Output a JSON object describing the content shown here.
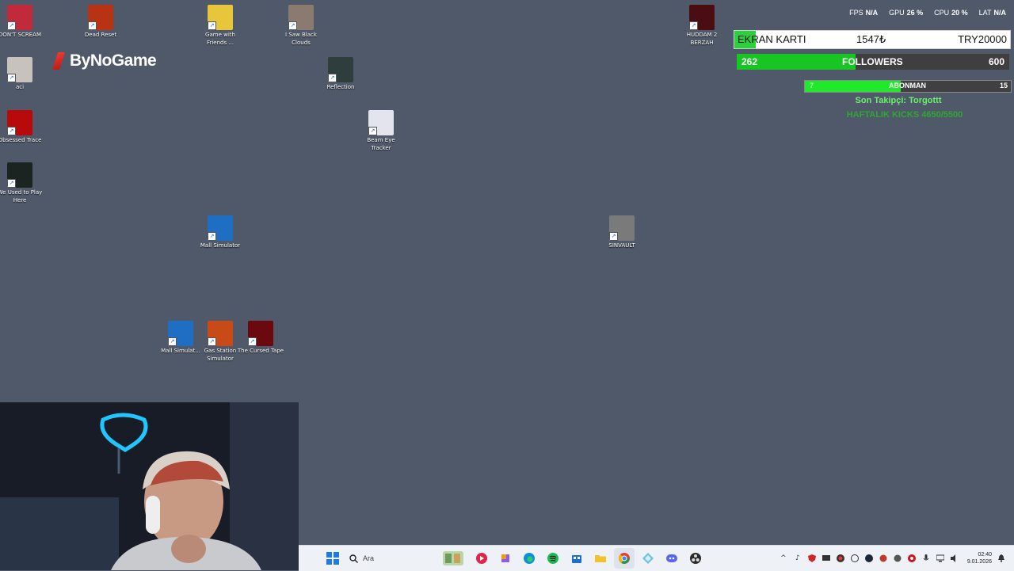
{
  "desktop_icons": [
    {
      "label": "DON'T SCREAM",
      "icon": "dont-scream-icon",
      "color": "#c12a3a"
    },
    {
      "label": "Dead Reset",
      "icon": "dead-reset-icon",
      "color": "#b83313"
    },
    {
      "label": "Game with Friends ...",
      "icon": "game-with-friends-icon",
      "color": "#e8c63a"
    },
    {
      "label": "I Saw Black Clouds",
      "icon": "i-saw-black-clouds-icon",
      "color": "#8a7a70"
    },
    {
      "label": "HUDDAM 2 BERZAH",
      "icon": "huddam-icon",
      "color": "#4a0e12"
    },
    {
      "label": "aci",
      "icon": "aci-icon",
      "color": "#c7c2bb"
    },
    {
      "label": "Reflection",
      "icon": "reflection-icon",
      "color": "#2e3e3c"
    },
    {
      "label": "Obsessed Trace",
      "icon": "obsessed-trace-icon",
      "color": "#b80a0a"
    },
    {
      "label": "Beam Eye Tracker",
      "icon": "beam-eye-tracker-icon",
      "color": "#e4e4ee"
    },
    {
      "label": "We Used to Play Here",
      "icon": "we-used-to-play-here-icon",
      "color": "#1b2420"
    },
    {
      "label": "Mall Simulator",
      "icon": "mall-simulator-icon",
      "color": "#1e6fc4"
    },
    {
      "label": "SINVAULT",
      "icon": "sinvault-icon",
      "color": "#7a7a7a"
    },
    {
      "label": "Mall Simulat...",
      "icon": "mall-simulator-2-icon",
      "color": "#1e6fc4"
    },
    {
      "label": "Gas Station Simulator",
      "icon": "gas-station-simulator-icon",
      "color": "#c84b17"
    },
    {
      "label": "The Cursed Tape",
      "icon": "the-cursed-tape-icon",
      "color": "#6a0a0e"
    }
  ],
  "brand": {
    "name": "ByNoGame"
  },
  "stats": {
    "fps_label": "FPS",
    "fps_value": "N/A",
    "gpu_label": "GPU",
    "gpu_value": "26 %",
    "cpu_label": "CPU",
    "cpu_value": "20 %",
    "lat_label": "LAT",
    "lat_value": "N/A"
  },
  "goals": {
    "gpu": {
      "title": "EKRAN KARTI",
      "current": "1547₺",
      "target": "TRY20000",
      "fraction": 0.077
    },
    "followers": {
      "current": "262",
      "title": "FOLLOWERS",
      "target": "600",
      "fraction": 0.437
    },
    "subs": {
      "current": "7",
      "title": "ABONMAN",
      "target": "15",
      "fraction": 0.467
    },
    "last_follower": "Son Takipçi: Torgottt",
    "weekly": "HAFTALIK KICKS 4650/5500"
  },
  "taskbar": {
    "search_placeholder": "Ara",
    "apps": [
      "windows-start-icon",
      "game-thumbnail-icon",
      "media-player-icon",
      "copilot-icon",
      "edge-icon",
      "spotify-icon",
      "store-icon",
      "file-explorer-icon",
      "chrome-icon",
      "network-tool-icon",
      "discord-icon",
      "obs-icon"
    ],
    "time": "02:40",
    "date": "9.01.2026"
  }
}
